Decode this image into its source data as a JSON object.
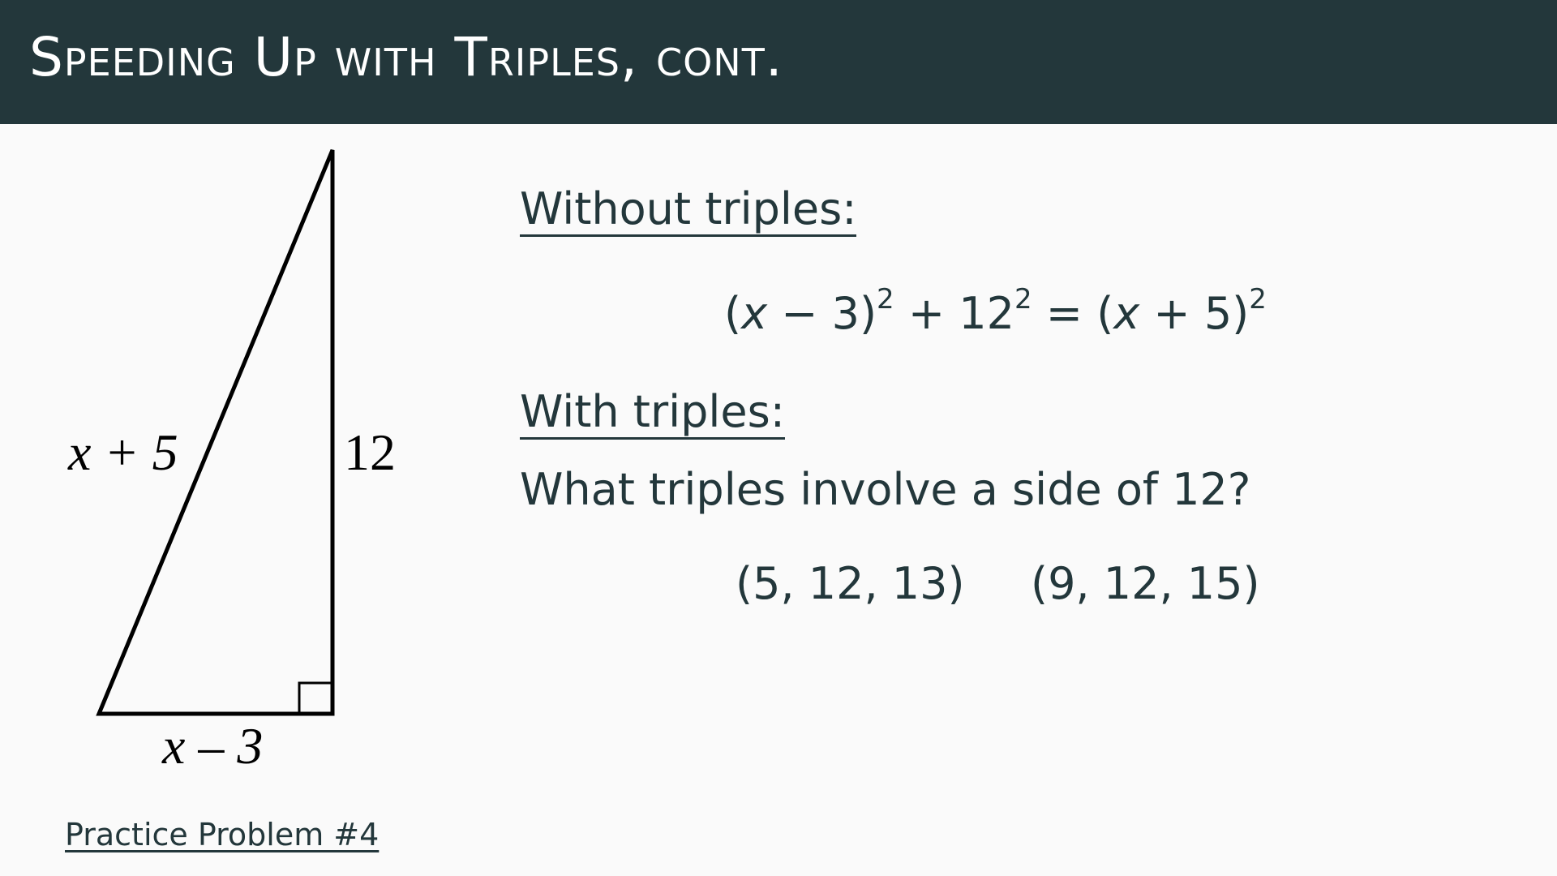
{
  "slide": {
    "title": "Speeding Up with Triples, cont."
  },
  "diagram": {
    "hypotenuse_label": "x + 5",
    "vertical_leg_label": "12",
    "base_label": "x – 3"
  },
  "content": {
    "without_heading": "Without triples:",
    "equation": {
      "open1": "(",
      "var1": "x",
      "rest1": " − 3)",
      "exp1": "2",
      "plus": " + 12",
      "exp2": "2",
      "equals": " = (",
      "var2": "x",
      "rest2": " + 5)",
      "exp3": "2"
    },
    "with_heading": "With triples:",
    "question": "What triples involve a side of 12?",
    "triples": [
      "(5, 12, 13)",
      "(9, 12, 15)"
    ]
  },
  "footer": {
    "practice_link": "Practice Problem #4"
  }
}
